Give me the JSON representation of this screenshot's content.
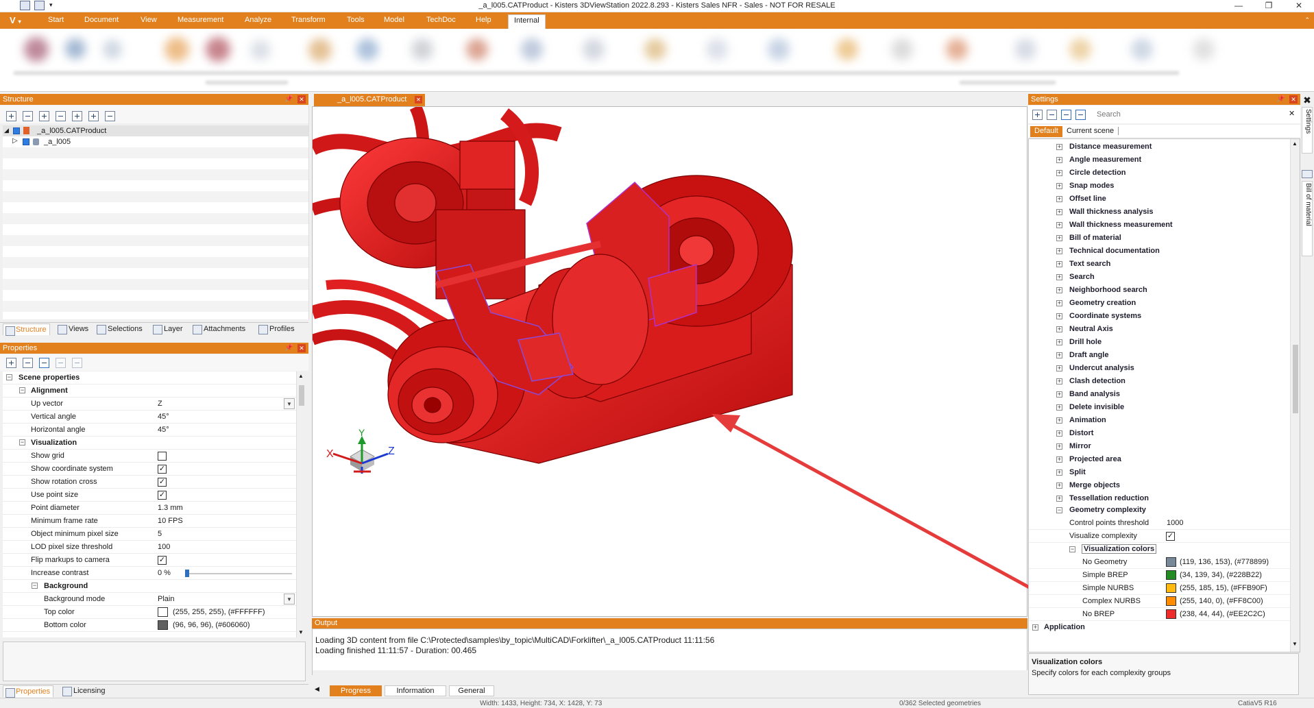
{
  "window": {
    "title": "_a_l005.CATProduct - Kisters 3DViewStation 2022.8.293 - Kisters Sales NFR - Sales - NOT FOR RESALE",
    "controls": [
      "—",
      "❐",
      "✕"
    ]
  },
  "menu": {
    "app_button": "V",
    "tabs": [
      "Start",
      "Document",
      "View",
      "Measurement",
      "Analyze",
      "Transform",
      "Tools",
      "Model",
      "TechDoc",
      "Help",
      "Internal"
    ],
    "active_tab": "Internal"
  },
  "structure": {
    "title": "Structure",
    "items": [
      "_a_l005.CATProduct",
      "_a_l005"
    ],
    "tabs": [
      "Structure",
      "Views",
      "Selections",
      "Layer",
      "Attachments",
      "Profiles"
    ]
  },
  "properties": {
    "title": "Properties",
    "scene_properties": "Scene properties",
    "alignment": "Alignment",
    "up_vector": {
      "label": "Up vector",
      "value": "Z"
    },
    "vertical_angle": {
      "label": "Vertical angle",
      "value": "45°"
    },
    "horizontal_angle": {
      "label": "Horizontal angle",
      "value": "45°"
    },
    "visualization": "Visualization",
    "show_grid": {
      "label": "Show grid",
      "checked": false
    },
    "show_coord": {
      "label": "Show coordinate system",
      "checked": true
    },
    "show_rotation": {
      "label": "Show rotation cross",
      "checked": true
    },
    "use_point_size": {
      "label": "Use point size",
      "checked": true
    },
    "point_diameter": {
      "label": "Point diameter",
      "value": "1.3 mm"
    },
    "min_frame_rate": {
      "label": "Minimum frame rate",
      "value": "10 FPS"
    },
    "obj_min_pixel": {
      "label": "Object minimum pixel size",
      "value": "5"
    },
    "lod_threshold": {
      "label": "LOD pixel size threshold",
      "value": "100"
    },
    "flip_markups": {
      "label": "Flip markups to camera",
      "checked": true
    },
    "increase_contrast": {
      "label": "Increase contrast",
      "value": "0 %",
      "fraction": 0
    },
    "background": "Background",
    "background_mode": {
      "label": "Background mode",
      "value": "Plain"
    },
    "top_color": {
      "label": "Top color",
      "value": "(255, 255, 255), (#FFFFFF)",
      "color": "#FFFFFF"
    },
    "bottom_color": {
      "label": "Bottom color",
      "value": "(96, 96, 96), (#606060)",
      "color": "#606060"
    },
    "tabs": [
      "Properties",
      "Licensing"
    ]
  },
  "document": {
    "tab_label": "_a_l005.CATProduct",
    "model_color": "#EE2C2C",
    "axes": [
      "X",
      "Y",
      "Z"
    ]
  },
  "output": {
    "title": "Output",
    "lines": [
      "Loading 3D content from file C:\\Protected\\samples\\by_topic\\MultiCAD\\Forklifter\\_a_l005.CATProduct 11:11:56",
      "Loading finished 11:11:57 - Duration: 00.465"
    ],
    "tabs": [
      "Progress",
      "Information",
      "General"
    ]
  },
  "settings": {
    "title": "Settings",
    "search_placeholder": "Search",
    "tabs": [
      "Default",
      "Current scene"
    ],
    "groups": [
      "Distance measurement",
      "Angle measurement",
      "Circle detection",
      "Snap modes",
      "Offset line",
      "Wall thickness analysis",
      "Wall thickness measurement",
      "Bill of material",
      "Technical documentation",
      "Text search",
      "Search",
      "Neighborhood search",
      "Geometry creation",
      "Coordinate systems",
      "Neutral Axis",
      "Drill hole",
      "Draft angle",
      "Undercut analysis",
      "Clash detection",
      "Band analysis",
      "Delete invisible",
      "Animation",
      "Distort",
      "Mirror",
      "Projected area",
      "Split",
      "Merge objects",
      "Tessellation reduction"
    ],
    "geometry_complexity": "Geometry complexity",
    "control_points": {
      "label": "Control points threshold",
      "value": "1000"
    },
    "visualize_complexity": {
      "label": "Visualize complexity",
      "checked": true
    },
    "visualization_colors": "Visualization colors",
    "colors": [
      {
        "label": "No Geometry",
        "value": "(119, 136, 153), (#778899)",
        "color": "#778899"
      },
      {
        "label": "Simple BREP",
        "value": "(34, 139, 34), (#228B22)",
        "color": "#228B22"
      },
      {
        "label": "Simple NURBS",
        "value": "(255, 185, 15), (#FFB90F)",
        "color": "#FFB90F"
      },
      {
        "label": "Complex NURBS",
        "value": "(255, 140, 0), (#FF8C00)",
        "color": "#FF8C00"
      },
      {
        "label": "No BREP",
        "value": "(238, 44, 44), (#EE2C2C)",
        "color": "#EE2C2C"
      }
    ],
    "application": "Application",
    "help_title": "Visualization colors",
    "help_text": "Specify colors for each complexity groups"
  },
  "sidebar": [
    "Settings",
    "Bill of material"
  ],
  "status": {
    "dims": "Width: 1433, Height: 734, X: 1428, Y: 73",
    "selected": "0/362 Selected geometries",
    "format": "CatiaV5 R16"
  },
  "colors": {
    "accent": "#E2801E",
    "highlight_box": "#E63B3B"
  }
}
